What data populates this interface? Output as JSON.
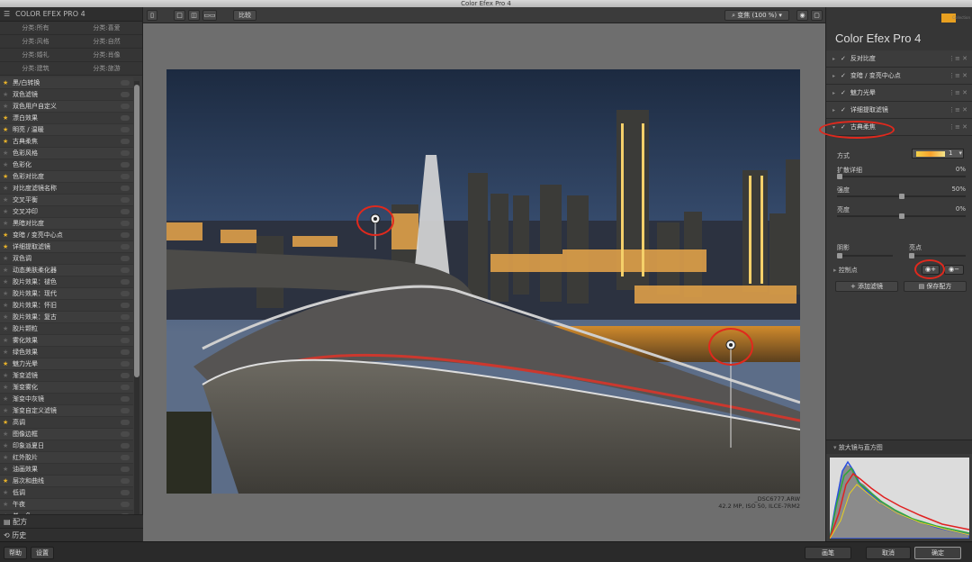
{
  "window": {
    "title": "Color Efex Pro 4"
  },
  "left_panel": {
    "title": "COLOR EFEX PRO 4",
    "categories": [
      "分类:所有",
      "分类:喜爱",
      "分类:风格",
      "分类:自然",
      "分类:婚礼",
      "分类:肖像",
      "分类:建筑",
      "分类:旅游"
    ],
    "filters": [
      {
        "label": "黑/白转换",
        "fav": true
      },
      {
        "label": "双色滤镜",
        "fav": false
      },
      {
        "label": "双色用户自定义",
        "fav": false
      },
      {
        "label": "漂白效果",
        "fav": true
      },
      {
        "label": "明亮 / 温暖",
        "fav": true
      },
      {
        "label": "古典柔焦",
        "fav": true
      },
      {
        "label": "色彩风格",
        "fav": false
      },
      {
        "label": "色彩化",
        "fav": false
      },
      {
        "label": "色彩对比度",
        "fav": true
      },
      {
        "label": "对比度滤镜名称",
        "fav": false
      },
      {
        "label": "交叉平衡",
        "fav": false
      },
      {
        "label": "交叉冲印",
        "fav": false
      },
      {
        "label": "黑暗对比度",
        "fav": false
      },
      {
        "label": "变暗 / 变亮中心点",
        "fav": true
      },
      {
        "label": "详细提取滤镜",
        "fav": true
      },
      {
        "label": "双色调",
        "fav": false
      },
      {
        "label": "动态美肤柔化器",
        "fav": false
      },
      {
        "label": "胶片效果：褪色",
        "fav": false
      },
      {
        "label": "胶片效果：现代",
        "fav": false
      },
      {
        "label": "胶片效果：怀旧",
        "fav": false
      },
      {
        "label": "胶片效果：复古",
        "fav": false
      },
      {
        "label": "胶片颗粒",
        "fav": false
      },
      {
        "label": "雾化效果",
        "fav": false
      },
      {
        "label": "绿色效果",
        "fav": false
      },
      {
        "label": "魅力光晕",
        "fav": true
      },
      {
        "label": "渐变滤镜",
        "fav": false
      },
      {
        "label": "渐变雾化",
        "fav": false
      },
      {
        "label": "渐变中灰镜",
        "fav": false
      },
      {
        "label": "渐变自定义滤镜",
        "fav": false
      },
      {
        "label": "高调",
        "fav": true
      },
      {
        "label": "图像边框",
        "fav": false
      },
      {
        "label": "印象派夏日",
        "fav": false
      },
      {
        "label": "红外胶片",
        "fav": false
      },
      {
        "label": "油画效果",
        "fav": false
      },
      {
        "label": "层次和曲线",
        "fav": true
      },
      {
        "label": "低调",
        "fav": false
      },
      {
        "label": "午夜",
        "fav": false
      },
      {
        "label": "单一色",
        "fav": false
      }
    ],
    "footer": [
      "配方",
      "历史"
    ]
  },
  "toolbar": {
    "compare_label": "比较",
    "zoom_label": "变焦 (100 %)"
  },
  "image": {
    "filename": "_DSC6777.ARW",
    "info": "42.2 MP, ISO 50, ILCE-7RM2"
  },
  "right_panel": {
    "brand": "Collection",
    "app_title": "Color Efex Pro 4",
    "effects": [
      {
        "label": "反对比度"
      },
      {
        "label": "变暗 / 变亮中心点"
      },
      {
        "label": "魅力光晕"
      },
      {
        "label": "详细提取滤镜"
      },
      {
        "label": "古典柔焦"
      }
    ],
    "method_label": "方式",
    "method_value": "1",
    "sliders": [
      {
        "label": "扩散详细",
        "value": "0%",
        "level": 0.0
      },
      {
        "label": "强度",
        "value": "50%",
        "level": 0.5
      },
      {
        "label": "亮度",
        "value": "0%",
        "level": 0.5
      }
    ],
    "shadows_label": "阴影",
    "highlights_label": "亮点",
    "control_points_label": "控制点",
    "add_filter_label": "添加滤镜",
    "save_recipe_label": "保存配方",
    "histogram_label": "放大镜与直方图"
  },
  "bottom_bar": {
    "help_label": "帮助",
    "settings_label": "设置",
    "brush_label": "画笔",
    "cancel_label": "取消",
    "ok_label": "确定"
  },
  "colors": {
    "annotation": "#e0291d",
    "star": "#e8b22a",
    "brand": "#e8a020"
  }
}
